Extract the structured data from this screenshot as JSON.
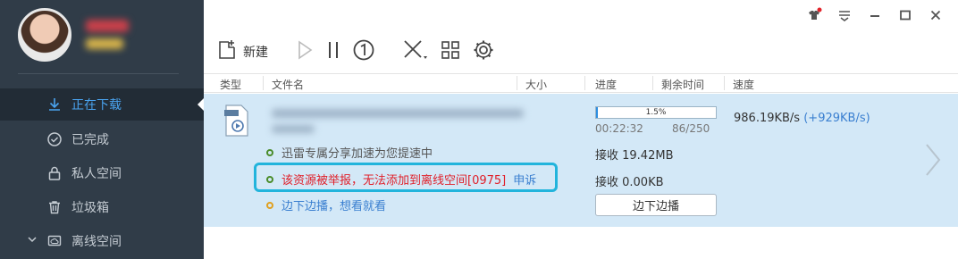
{
  "toolbar": {
    "new_label": "新建"
  },
  "sidebar": {
    "items": [
      {
        "label": "正在下载",
        "icon": "download-icon",
        "active": true
      },
      {
        "label": "已完成",
        "icon": "check-circle-icon"
      },
      {
        "label": "私人空间",
        "icon": "lock-icon"
      },
      {
        "label": "垃圾箱",
        "icon": "trash-icon"
      },
      {
        "label": "离线空间",
        "icon": "cloud-folder-icon"
      }
    ]
  },
  "columns": [
    "类型",
    "文件名",
    "大小",
    "进度",
    "剩余时间",
    "速度"
  ],
  "task": {
    "messages": [
      {
        "text": "迅雷专属分享加速为您提速中",
        "color": "#4a8c2a"
      },
      {
        "text": "该资源被举报，无法添加到离线空间[0975]",
        "link": "申诉",
        "color": "#e0202a"
      },
      {
        "text": "边下边播，想看就看",
        "color": "#3a7fd0"
      }
    ],
    "progress": "1.5%",
    "progress_fraction": 0.015,
    "elapsed": "00:22:32",
    "pieces": "86/250",
    "received_a": "接收 19.42MB",
    "received_b": "接收 0.00KB",
    "speed": "986.19KB/s",
    "speed_boost": "(+929KB/s)",
    "play_button": "边下边播"
  },
  "colors": {
    "sidebar_bg": "#303c48",
    "active_text": "#4aa3ef",
    "task_bg": "#d3e8f7",
    "highlight_border": "#22b4dc"
  }
}
